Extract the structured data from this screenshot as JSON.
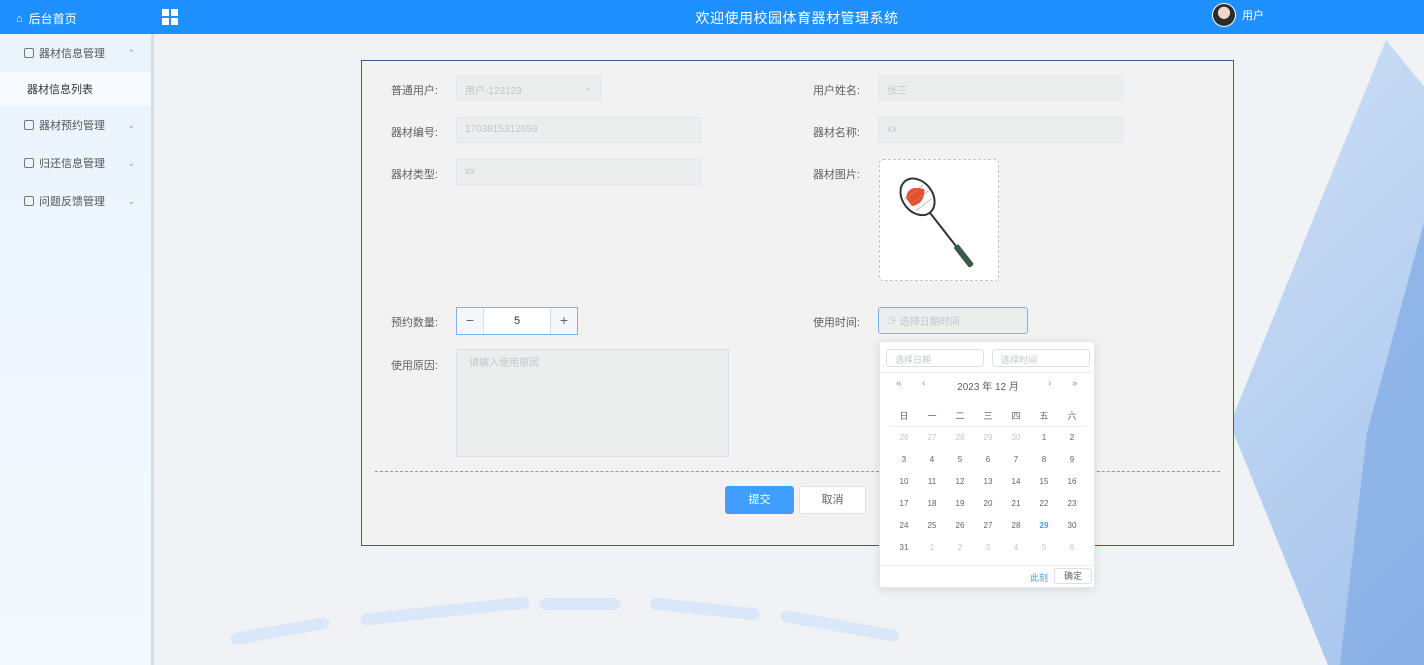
{
  "topbar": {
    "home_label": "后台首页",
    "title": "欢迎使用校园体育器材管理系统",
    "user_label": "用户",
    "color": "#1e90ff"
  },
  "sidebar": {
    "items": [
      {
        "label": "器材信息管理",
        "arrow": "⌃"
      },
      {
        "label": "器材信息列表"
      },
      {
        "label": "器材预约管理",
        "arrow": "⌄"
      },
      {
        "label": "归还信息管理",
        "arrow": "⌄"
      },
      {
        "label": "问题反馈管理",
        "arrow": "⌄"
      }
    ]
  },
  "form": {
    "user_label": "普通用户:",
    "user_value": "用户-123123",
    "name_label": "用户姓名:",
    "name_value": "张三",
    "code_label": "器材编号:",
    "code_value": "1703815312659",
    "equip_name_label": "器材名称:",
    "equip_name_value": "xx",
    "type_label": "器材类型:",
    "type_value": "xx",
    "image_label": "器材图片:",
    "qty_label": "预约数量:",
    "qty_value": "5",
    "qty_minus": "−",
    "qty_plus": "+",
    "time_label": "使用时间:",
    "time_placeholder": "选择日期时间",
    "reason_label": "使用原因:",
    "reason_placeholder": "请输入使用原因",
    "submit_label": "提交",
    "cancel_label": "取消"
  },
  "picker": {
    "date_placeholder": "选择日期",
    "time_placeholder": "选择时间",
    "year_month": "2023 年  12 月",
    "nav_prev_year": "«",
    "nav_prev_month": "‹",
    "nav_next_month": "›",
    "nav_next_year": "»",
    "weekdays": [
      "日",
      "一",
      "二",
      "三",
      "四",
      "五",
      "六"
    ],
    "weeks": [
      [
        "26",
        "27",
        "28",
        "29",
        "30",
        "1",
        "2"
      ],
      [
        "3",
        "4",
        "5",
        "6",
        "7",
        "8",
        "9"
      ],
      [
        "10",
        "11",
        "12",
        "13",
        "14",
        "15",
        "16"
      ],
      [
        "17",
        "18",
        "19",
        "20",
        "21",
        "22",
        "23"
      ],
      [
        "24",
        "25",
        "26",
        "27",
        "28",
        "29",
        "30"
      ],
      [
        "31",
        "1",
        "2",
        "3",
        "4",
        "5",
        "6"
      ]
    ],
    "today": "29",
    "now_label": "此刻",
    "ok_label": "确定"
  }
}
